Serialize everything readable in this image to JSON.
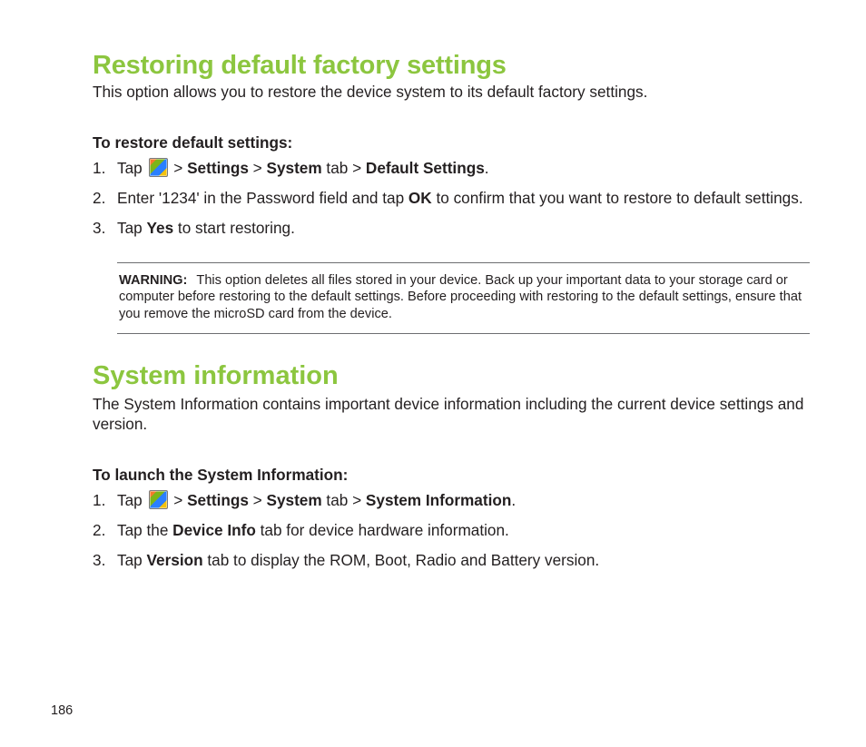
{
  "page_number": "186",
  "section1": {
    "title": "Restoring default factory settings",
    "intro": "This option allows you to restore the device system to its default factory settings.",
    "subheading": "To restore default settings:",
    "steps": {
      "s1": {
        "tap": "Tap ",
        "gt1": " > ",
        "settings": "Settings",
        "gt2": " > ",
        "system": "System",
        "tab_word": " tab > ",
        "target": "Default Settings",
        "period": "."
      },
      "s2": {
        "pre": "Enter '1234' in the Password field and tap ",
        "ok": "OK",
        "post": " to confirm that you want to restore to default settings."
      },
      "s3": {
        "pre": "Tap ",
        "yes": "Yes",
        "post": " to start restoring."
      }
    },
    "warning": {
      "label": "WARNING:",
      "text": "This option deletes all files stored in your device. Back up your important data to your storage card or computer before restoring to the default settings. Before proceeding with restoring to the default settings, ensure that you remove the microSD card from the device."
    }
  },
  "section2": {
    "title": "System information",
    "intro": "The System Information contains important device information including the current device settings and version.",
    "subheading": "To launch the System Information:",
    "steps": {
      "s1": {
        "tap": "Tap ",
        "gt1": " > ",
        "settings": "Settings",
        "gt2": " > ",
        "system": "System",
        "tab_word": " tab > ",
        "target": "System Information",
        "period": "."
      },
      "s2": {
        "pre": "Tap the ",
        "device_info": "Device Info",
        "post": " tab for device hardware information."
      },
      "s3": {
        "pre": "Tap ",
        "version": "Version",
        "post": " tab to display the ROM, Boot, Radio and Battery version."
      }
    }
  }
}
